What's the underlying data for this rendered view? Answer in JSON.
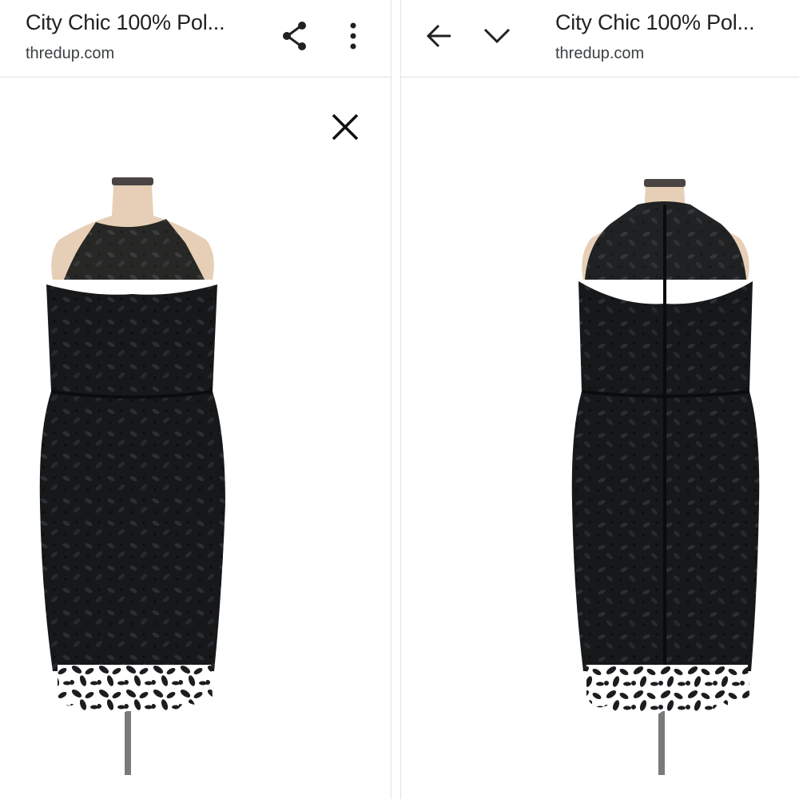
{
  "left_pane": {
    "title": "City Chic 100% Pol...",
    "site": "thredup.com",
    "icons": {
      "share": "share-icon",
      "more": "more-vert-icon",
      "close": "close-icon"
    },
    "image": {
      "subject": "dress-front-view"
    }
  },
  "right_pane": {
    "title": "City Chic 100% Pol...",
    "site": "thredup.com",
    "icons": {
      "back": "arrow-back-icon",
      "expand": "chevron-down-icon"
    },
    "image": {
      "subject": "dress-back-view"
    }
  },
  "colors": {
    "background": "#ffffff",
    "text_primary": "#202124",
    "text_secondary": "#3c4043",
    "divider": "#e2e2e2",
    "dress": "#151719",
    "skin": "#e6cfb6"
  }
}
